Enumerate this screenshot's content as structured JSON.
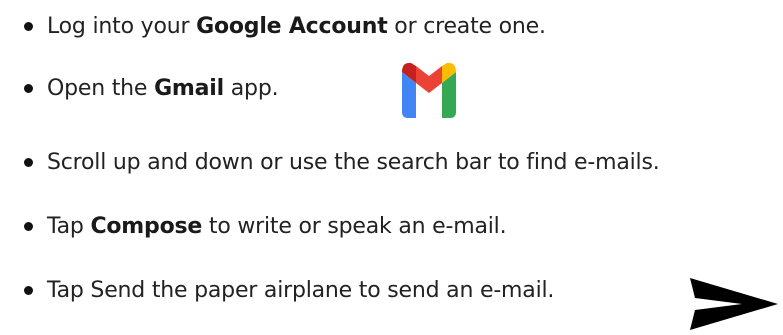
{
  "steps": [
    {
      "pre": "Log into your ",
      "bold": "Google Account",
      "post": " or create one."
    },
    {
      "pre": "Open the ",
      "bold": "Gmail",
      "post": " app."
    },
    {
      "text": "Scroll up and down or use the search bar to find e-mails."
    },
    {
      "pre": "Tap ",
      "bold": "Compose",
      "post": " to write or speak an e-mail."
    },
    {
      "text": "Tap Send the paper airplane to send an e-mail."
    }
  ],
  "icons": {
    "gmail": "gmail-logo-icon",
    "send": "send-paper-airplane-icon"
  },
  "colors": {
    "gmail_blue": "#4285F4",
    "gmail_red": "#EA4335",
    "gmail_yellow": "#FBBC04",
    "gmail_green": "#34A853",
    "gmail_dark_red": "#C5221F",
    "send_icon": "#000000"
  }
}
